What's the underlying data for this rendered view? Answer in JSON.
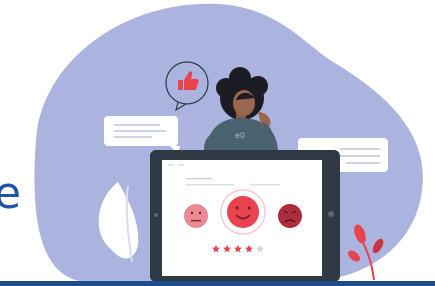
{
  "partial_heading": "e",
  "rating": {
    "stars_filled": 4,
    "stars_total": 5
  },
  "icons": {
    "thumbs_up": "thumbs-up-icon",
    "happy_face": "happy-face-icon",
    "neutral_face": "neutral-face-icon",
    "sad_face": "sad-face-icon",
    "star": "star-icon"
  },
  "colors": {
    "blob": "#abb4de",
    "heading": "#1f55a4",
    "accent_red": "#e8434f",
    "neutral_face": "#ec8a93",
    "sad_face": "#ad2d3e",
    "tablet_frame": "#2f3a45",
    "bottom_bar": "#1f4d8c",
    "star_empty": "#cfd3dc"
  }
}
